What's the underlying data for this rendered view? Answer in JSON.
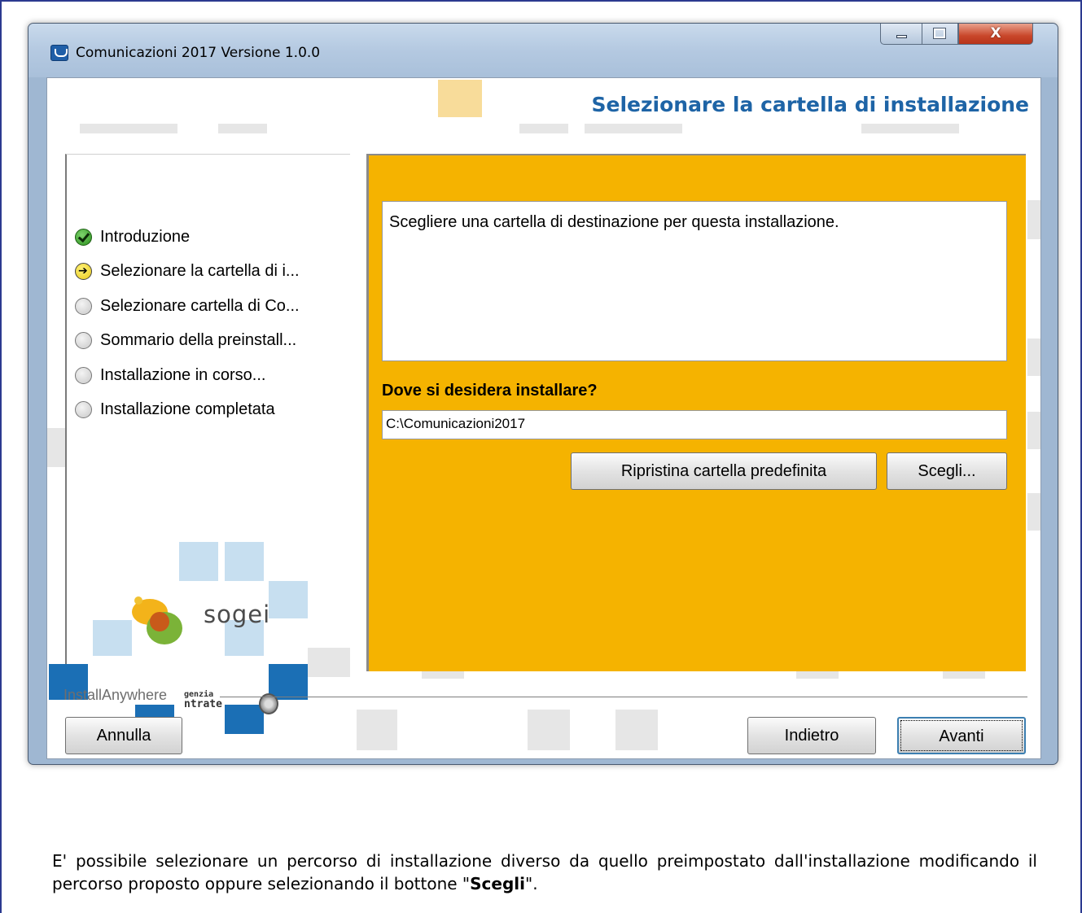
{
  "window": {
    "title": "Comunicazioni 2017 Versione 1.0.0",
    "close_glyph": "X"
  },
  "header": {
    "title": "Selezionare la cartella di installazione"
  },
  "steps": [
    {
      "label": "Introduzione",
      "state": "done"
    },
    {
      "label": "Selezionare la cartella di i...",
      "state": "current"
    },
    {
      "label": "Selezionare cartella di Co...",
      "state": "pending"
    },
    {
      "label": "Sommario della preinstall...",
      "state": "pending"
    },
    {
      "label": "Installazione in corso...",
      "state": "pending"
    },
    {
      "label": "Installazione completata",
      "state": "pending"
    }
  ],
  "branding": {
    "sogei": "sogei",
    "entrate_line1": "genzia",
    "entrate_line2": "ntrate"
  },
  "content": {
    "description": "Scegliere una cartella di destinazione per questa installazione.",
    "question": "Dove si desidera installare?",
    "path_value": "C:\\Comunicazioni2017",
    "restore_button": "Ripristina cartella predefinita",
    "choose_button": "Scegli..."
  },
  "footer": {
    "vendor": "InstallAnywhere",
    "cancel_button": "Annulla",
    "back_button": "Indietro",
    "next_button": "Avanti"
  },
  "caption": {
    "text_before": "E' possibile selezionare un percorso di installazione diverso da quello preimpostato dall'installazione modificando il percorso proposto oppure selezionando il bottone \"",
    "bold": "Scegli",
    "text_after": "\"."
  },
  "colors": {
    "accent_orange": "#f5b300",
    "header_blue": "#1e64a6"
  }
}
